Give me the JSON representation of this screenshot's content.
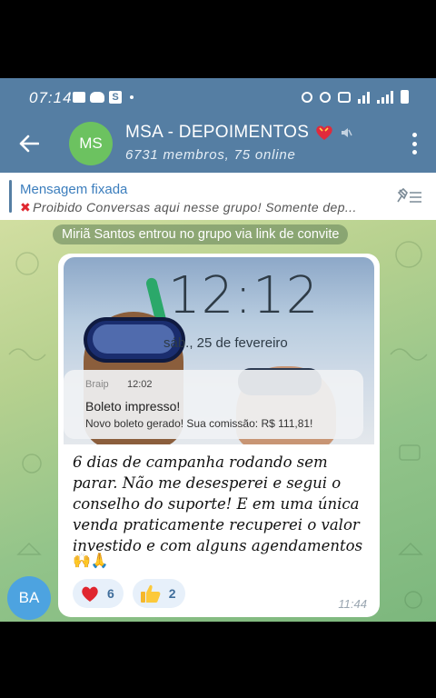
{
  "status_bar": {
    "time": "07:14"
  },
  "header": {
    "avatar_initials": "MS",
    "title": "MSA - DEPOIMENTOS",
    "subtitle": "6731 membros, 75 online",
    "avatar_color": "#6cc260",
    "bar_color": "#557ea3"
  },
  "pinned": {
    "title": "Mensagem fixada",
    "text": "Proibido Conversas aqui nesse grupo!  Somente dep..."
  },
  "service_message": "Miriã Santos entrou no grupo via link de convite",
  "message": {
    "sender_initials": "BA",
    "sender_avatar_color": "#4da3e0",
    "photo": {
      "lock_time": "12:12",
      "lock_date": "sáb., 25 de fevereiro",
      "notification_app": "Braip",
      "notification_time": "12:02",
      "notification_title": "Boleto impresso!",
      "notification_body": "Novo boleto gerado! Sua comissão: R$ 111,81!"
    },
    "caption": "6 dias de campanha rodando sem parar. Não me desesperei e segui o conselho do suporte! E em uma única venda praticamente recuperei o valor investido e com alguns agendamentos",
    "caption_emoji": "🙌🙏",
    "reactions": [
      {
        "icon": "heart",
        "emoji": "❤️",
        "count": "6"
      },
      {
        "icon": "thumbs-up",
        "emoji": "👍",
        "count": "2"
      }
    ],
    "time": "11:44"
  }
}
